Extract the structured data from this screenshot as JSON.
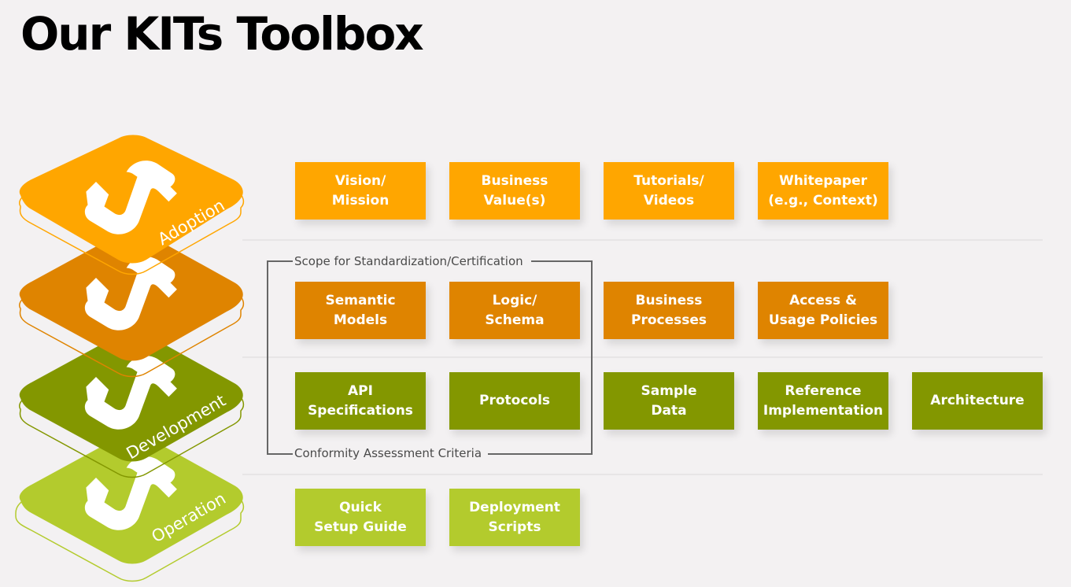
{
  "page": {
    "title": "Our KITs Toolbox"
  },
  "layers": [
    {
      "label": "Adoption",
      "color": "#ffa600",
      "icon": "kit-logo-icon"
    },
    {
      "label": "",
      "color": "#df8400",
      "icon": "kit-logo-icon"
    },
    {
      "label": "Development",
      "color": "#839700",
      "icon": "kit-logo-icon"
    },
    {
      "label": "Operation",
      "color": "#b3cb2d",
      "icon": "kit-logo-icon"
    }
  ],
  "rows": {
    "adoption": [
      {
        "label": "Vision/\nMission"
      },
      {
        "label": "Business\nValue(s)"
      },
      {
        "label": "Tutorials/\nVideos"
      },
      {
        "label": "Whitepaper\n(e.g., Context)"
      }
    ],
    "semantics": [
      {
        "label": "Semantic\nModels"
      },
      {
        "label": "Logic/\nSchema"
      },
      {
        "label": "Business\nProcesses"
      },
      {
        "label": "Access &\nUsage Policies"
      }
    ],
    "development": [
      {
        "label": "API\nSpecifications"
      },
      {
        "label": "Protocols"
      },
      {
        "label": "Sample\nData"
      },
      {
        "label": "Reference\nImplementation"
      },
      {
        "label": "Architecture"
      }
    ],
    "operation": [
      {
        "label": "Quick\nSetup Guide"
      },
      {
        "label": "Deployment\nScripts"
      }
    ]
  },
  "bracket": {
    "top_label": "Scope for Standardization/Certification",
    "bottom_label": "Conformity Assessment Criteria"
  }
}
